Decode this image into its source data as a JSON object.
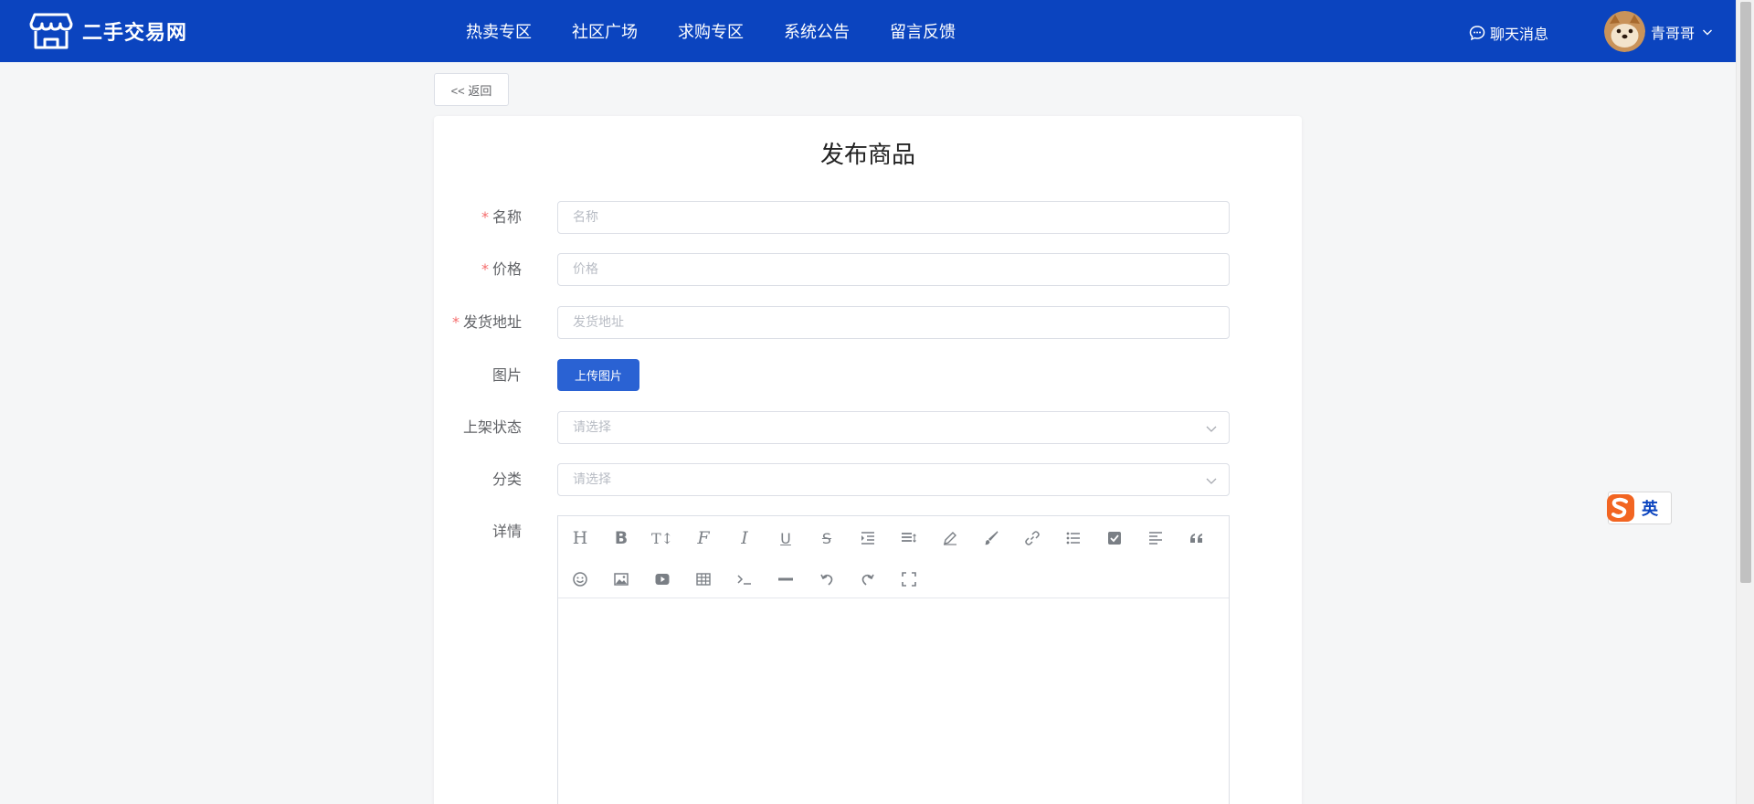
{
  "header": {
    "logo_text": "二手交易网",
    "nav": [
      "热卖专区",
      "社区广场",
      "求购专区",
      "系统公告",
      "留言反馈"
    ],
    "chat_label": "聊天消息",
    "user_name": "青哥哥"
  },
  "back_label": "<< 返回",
  "page_title": "发布商品",
  "form": {
    "name_label": "名称",
    "name_placeholder": "名称",
    "price_label": "价格",
    "price_placeholder": "价格",
    "address_label": "发货地址",
    "address_placeholder": "发货地址",
    "image_label": "图片",
    "upload_label": "上传图片",
    "status_label": "上架状态",
    "status_placeholder": "请选择",
    "category_label": "分类",
    "category_placeholder": "请选择",
    "detail_label": "详情",
    "required_mark": "*"
  },
  "editor_tools_row1": [
    "heading-icon",
    "bold-icon",
    "font-size-icon",
    "font-family-icon",
    "italic-icon",
    "underline-icon",
    "strikethrough-icon",
    "indent-icon",
    "line-height-icon",
    "pen-icon",
    "brush-icon",
    "link-icon",
    "list-icon",
    "checkbox-icon",
    "align-left-icon",
    "quote-icon"
  ],
  "editor_tools_row2": [
    "emoji-icon",
    "image-icon",
    "video-icon",
    "table-icon",
    "code-icon",
    "divider-icon",
    "undo-icon",
    "redo-icon",
    "fullscreen-icon"
  ],
  "editor_tool_glyphs": {
    "heading": "H",
    "bold": "B",
    "font_size": "T↕",
    "font_family": "F",
    "italic": "I",
    "underline": "U",
    "strikethrough": "S"
  },
  "ime": {
    "text": "英"
  },
  "colors": {
    "header_bg": "#0b44bf",
    "primary_button": "#2a62d3",
    "required": "#f56c6c",
    "ime_brand": "#f26522"
  }
}
